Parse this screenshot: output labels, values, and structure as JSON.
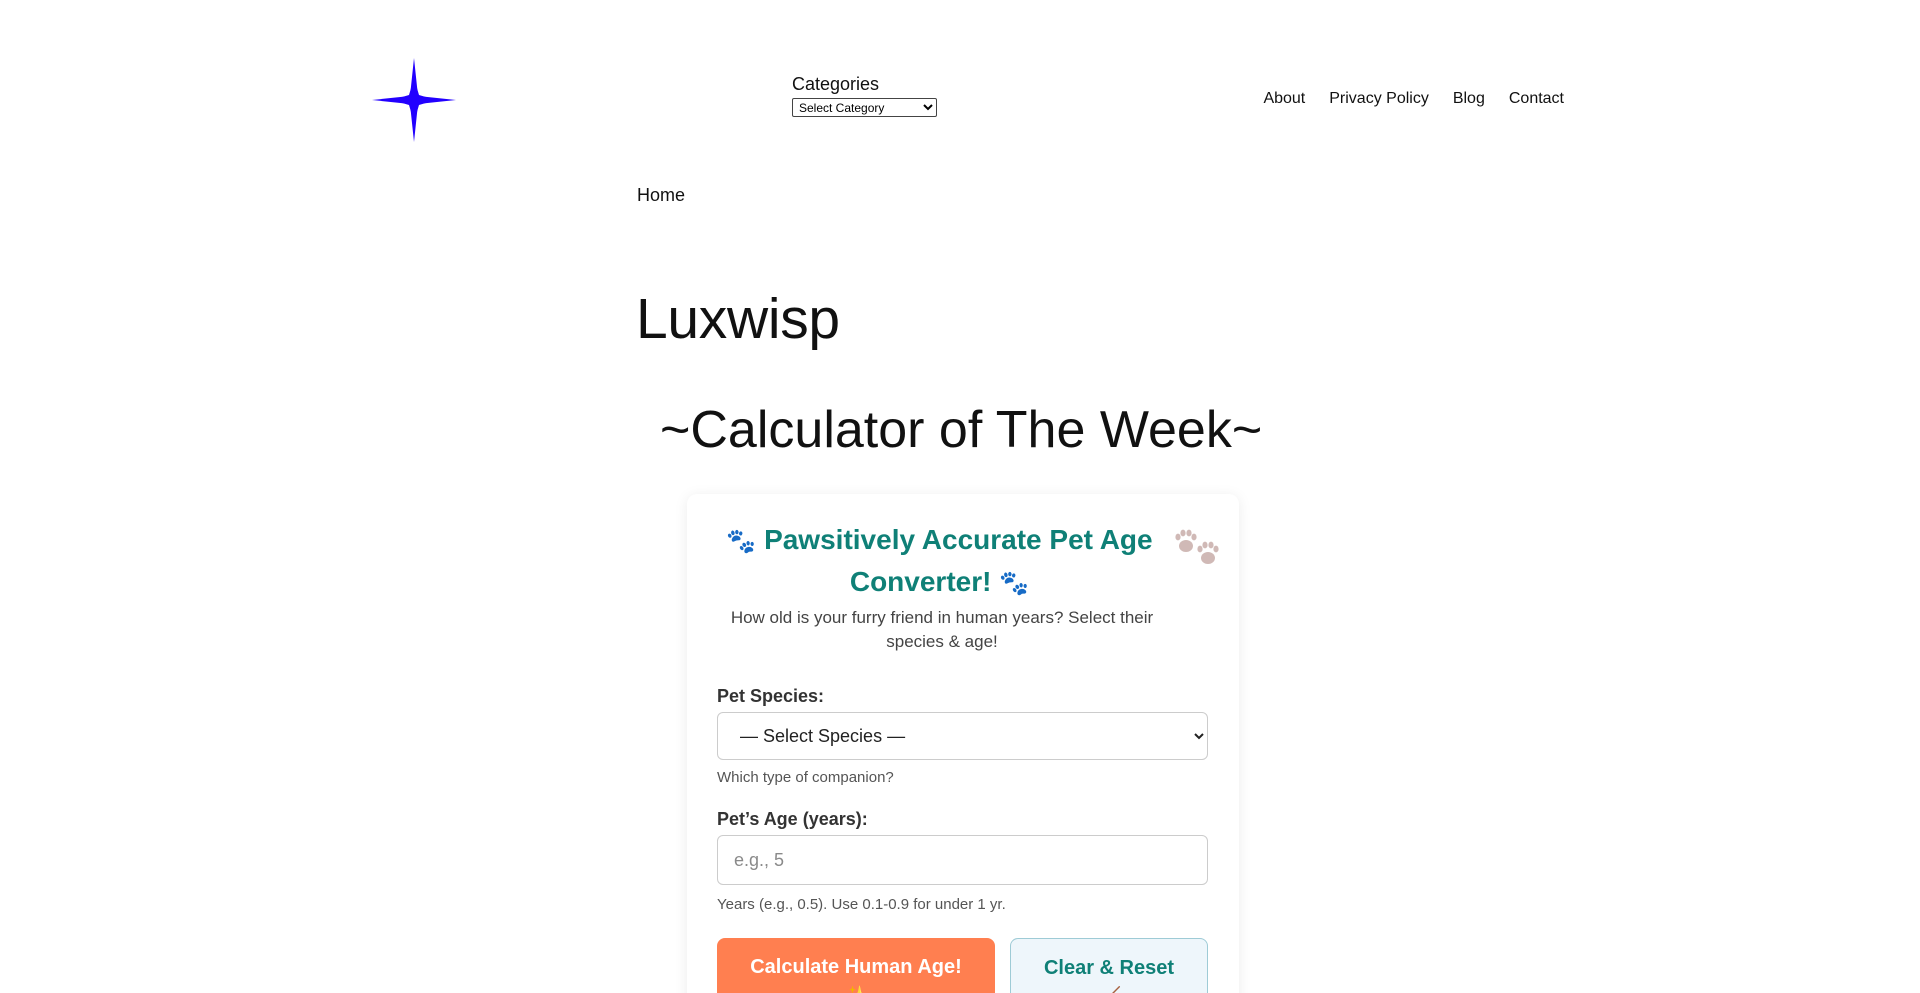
{
  "header": {
    "logo_icon": "four-point-star-icon",
    "logo_color": "#2200ff",
    "categories_label": "Categories",
    "categories_select_value": "Select Category",
    "nav": [
      "About",
      "Privacy Policy",
      "Blog",
      "Contact"
    ]
  },
  "breadcrumb": "Home",
  "site_title": "Luxwisp",
  "section_heading": "~Calculator of The Week~",
  "calculator": {
    "title_left_icon": "🐾",
    "title_text": "Pawsitively Accurate Pet Age Converter!",
    "title_right_icon": "🐾",
    "decor_icon": "paw-prints-icon",
    "subtitle": "How old is your furry friend in human years? Select their species & age!",
    "species_label": "Pet Species:",
    "species_value": "— Select Species —",
    "species_hint": "Which type of companion?",
    "age_label": "Pet’s Age (years):",
    "age_placeholder": "e.g., 5",
    "age_hint": "Years (e.g., 0.5). Use 0.1-0.9 for under 1 yr.",
    "calc_button_label": "Calculate Human Age!",
    "calc_button_icon": "✨",
    "reset_button_label": "Clear & Reset",
    "reset_button_icon": "🧹",
    "accent_color": "#0f8077",
    "calc_button_color": "#ff7f50"
  }
}
